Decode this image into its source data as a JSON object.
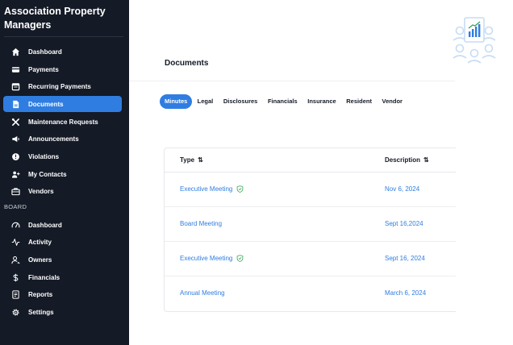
{
  "app": {
    "name": "Association Property Managers"
  },
  "sidebar": {
    "items": [
      {
        "label": "Dashboard",
        "icon": "home-icon"
      },
      {
        "label": "Payments",
        "icon": "credit-card-icon"
      },
      {
        "label": "Recurring Payments",
        "icon": "calendar-icon"
      },
      {
        "label": "Documents",
        "icon": "document-icon",
        "active": true
      },
      {
        "label": "Maintenance Requests",
        "icon": "tools-icon"
      },
      {
        "label": "Announcements",
        "icon": "megaphone-icon"
      },
      {
        "label": "Violations",
        "icon": "alert-icon"
      },
      {
        "label": "My Contacts",
        "icon": "add-person-icon"
      },
      {
        "label": "Vendors",
        "icon": "briefcase-icon"
      }
    ],
    "section_label": "BOARD",
    "board_items": [
      {
        "label": "Dashboard",
        "icon": "gauge-icon"
      },
      {
        "label": "Activity",
        "icon": "activity-icon"
      },
      {
        "label": "Owners",
        "icon": "owner-icon"
      },
      {
        "label": "Financials",
        "icon": "dollar-icon"
      },
      {
        "label": "Reports",
        "icon": "report-icon"
      },
      {
        "label": "Settings",
        "icon": "gear-icon"
      }
    ]
  },
  "main": {
    "title": "Documents",
    "tabs": [
      "Minutes",
      "Legal",
      "Disclosures",
      "Financials",
      "Insurance",
      "Resident",
      "Vendor"
    ],
    "active_tab": "Minutes",
    "table": {
      "columns": [
        {
          "label": "Type",
          "sort_icon": "⇅"
        },
        {
          "label": "Description",
          "sort_icon": "⇅"
        }
      ],
      "rows": [
        {
          "type": "Executive Meeting",
          "verified": true,
          "description": "Nov 6, 2024"
        },
        {
          "type": "Board Meeting",
          "verified": false,
          "description": "Sept 16,2024"
        },
        {
          "type": "Executive Meeting",
          "verified": true,
          "description": "Sept 16, 2024"
        },
        {
          "type": "Annual Meeting",
          "verified": false,
          "description": "March 6, 2024"
        }
      ]
    }
  },
  "colors": {
    "sidebar_bg": "#141a26",
    "accent": "#2f7de1",
    "verified": "#3aa655"
  }
}
